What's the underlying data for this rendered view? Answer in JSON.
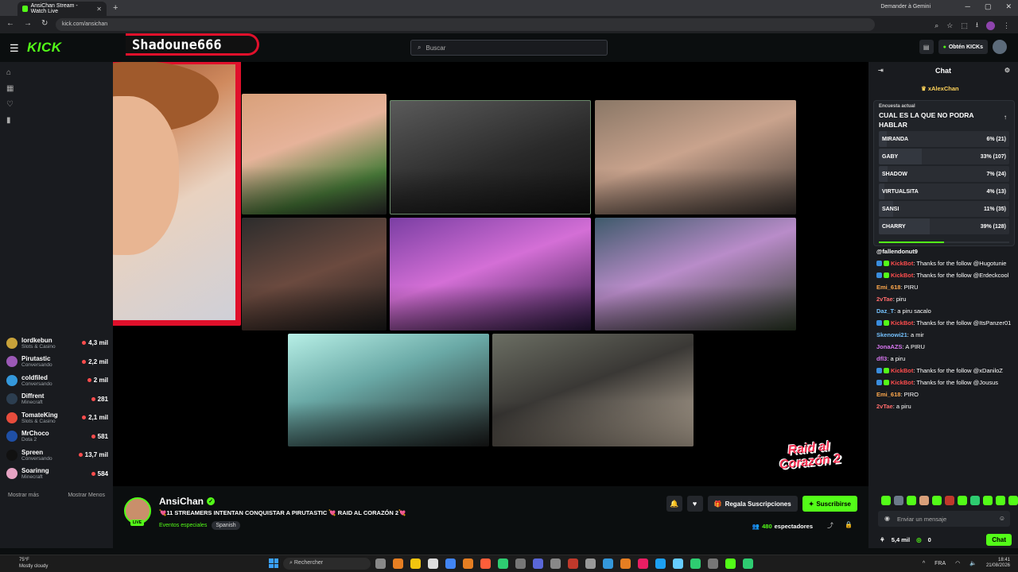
{
  "browser": {
    "tab_title": "AnsiChan Stream - Watch Live",
    "url": "kick.com/ansichan",
    "gemini_label": "Demander à Gemini"
  },
  "topnav": {
    "logo": "KICK",
    "search_placeholder": "Buscar",
    "kicks_label": "Obtén KICKs"
  },
  "overlay": {
    "streamer_tag": "Shadoune666",
    "raid_logo_line1": "Raid al",
    "raid_logo_line2": "Corazón 2"
  },
  "sidebar": {
    "channels": [
      {
        "name": "lordkebun",
        "category": "Slots & Casino",
        "viewers": "4,3 mil",
        "color": "#c8a23a",
        "live_dot": false
      },
      {
        "name": "Pirutastic",
        "category": "Conversando",
        "viewers": "2,2 mil",
        "color": "#9b59b6",
        "live_dot": false
      },
      {
        "name": "coldfiled",
        "category": "Conversando",
        "viewers": "2 mil",
        "color": "#3498db",
        "live_dot": false
      },
      {
        "name": "Diffrent",
        "category": "Minecraft",
        "viewers": "281",
        "color": "#2c3e50",
        "live_dot": false
      },
      {
        "name": "TomateKing",
        "category": "Slots & Casino",
        "viewers": "2,1 mil",
        "color": "#e74c3c",
        "live_dot": false
      },
      {
        "name": "MrChoco",
        "category": "Dota 2",
        "viewers": "581",
        "color": "#1f4fa5",
        "live_dot": true
      },
      {
        "name": "Spreen",
        "category": "Conversando",
        "viewers": "13,7 mil",
        "color": "#111111",
        "live_dot": false
      },
      {
        "name": "Soarinng",
        "category": "Minecraft",
        "viewers": "584",
        "color": "#e6a3c3",
        "live_dot": false
      }
    ],
    "show_more": "Mostrar más",
    "show_less": "Mostrar Menos"
  },
  "channel": {
    "name": "AnsiChan",
    "live_badge": "LIVE",
    "title": "💘11 STREAMERS INTENTAN CONQUISTAR A PIRUTASTIC 💘 RAID AL CORAZÓN 2💘",
    "category": "Eventos especiales",
    "language": "Spanish",
    "gift_label": "Regala Suscripciones",
    "subscribe_label": "Suscribirse",
    "viewers_count": "480",
    "viewers_label": "espectadores"
  },
  "chat": {
    "header": "Chat",
    "pinned_user": "xAlexChan",
    "poll": {
      "label": "Encuesta actual",
      "question": "CUAL ES LA QUE NO PODRA HABLAR",
      "options": [
        {
          "name": "MIRANDA",
          "result": "6% (21)",
          "pct": 6
        },
        {
          "name": "GABY",
          "result": "33% (107)",
          "pct": 33
        },
        {
          "name": "SHADOW",
          "result": "7% (24)",
          "pct": 7
        },
        {
          "name": "VIRTUALSITA",
          "result": "4% (13)",
          "pct": 4
        },
        {
          "name": "SANSI",
          "result": "11% (35)",
          "pct": 11
        },
        {
          "name": "CHARRY",
          "result": "39% (128)",
          "pct": 39
        }
      ],
      "time_remaining_fraction": 0.5
    },
    "messages": [
      {
        "user": "@fallendonut9",
        "text": "",
        "color": "#ffffff"
      },
      {
        "user": "KickBot",
        "text": ": Thanks for the follow @Hugotunie",
        "color": "#ff4d4d"
      },
      {
        "user": "KickBot",
        "text": ": Thanks for the follow @Erdeckcool",
        "color": "#ff4d4d"
      },
      {
        "user": "Emi_618",
        "text": ": PIRU",
        "color": "#ffa94d"
      },
      {
        "user": "2vTae",
        "text": ": piru",
        "color": "#ff6b6b"
      },
      {
        "user": "Daz_T",
        "text": ": a piru sacalo",
        "color": "#74c0fc"
      },
      {
        "user": "KickBot",
        "text": ": Thanks for the follow @ItsPanzer01",
        "color": "#ff4d4d"
      },
      {
        "user": "Skenowi21",
        "text": ": a mir",
        "color": "#74c0fc"
      },
      {
        "user": "JonaAZS",
        "text": ": A PIRU",
        "color": "#da77f2"
      },
      {
        "user": "dfl3",
        "text": ": a piru",
        "color": "#da77f2"
      },
      {
        "user": "KickBot",
        "text": ": Thanks for the follow @xDaniloZ",
        "color": "#ff4d4d"
      },
      {
        "user": "KickBot",
        "text": ": Thanks for the follow @Jousus",
        "color": "#ff4d4d"
      },
      {
        "user": "Emi_618",
        "text": ": PIRO",
        "color": "#ffa94d"
      },
      {
        "user": "2vTae",
        "text": ": a piru",
        "color": "#ff6b6b"
      }
    ],
    "input_placeholder": "Enviar un mensaje",
    "footer_count": "5,4 mil",
    "footer_points": "0",
    "chat_button": "Chat"
  },
  "taskbar": {
    "weather_temp": "75°F",
    "weather_desc": "Mostly cloudy",
    "search_placeholder": "Rechercher",
    "lang": "FRA",
    "time": "18:41",
    "date": "21/08/2026"
  }
}
